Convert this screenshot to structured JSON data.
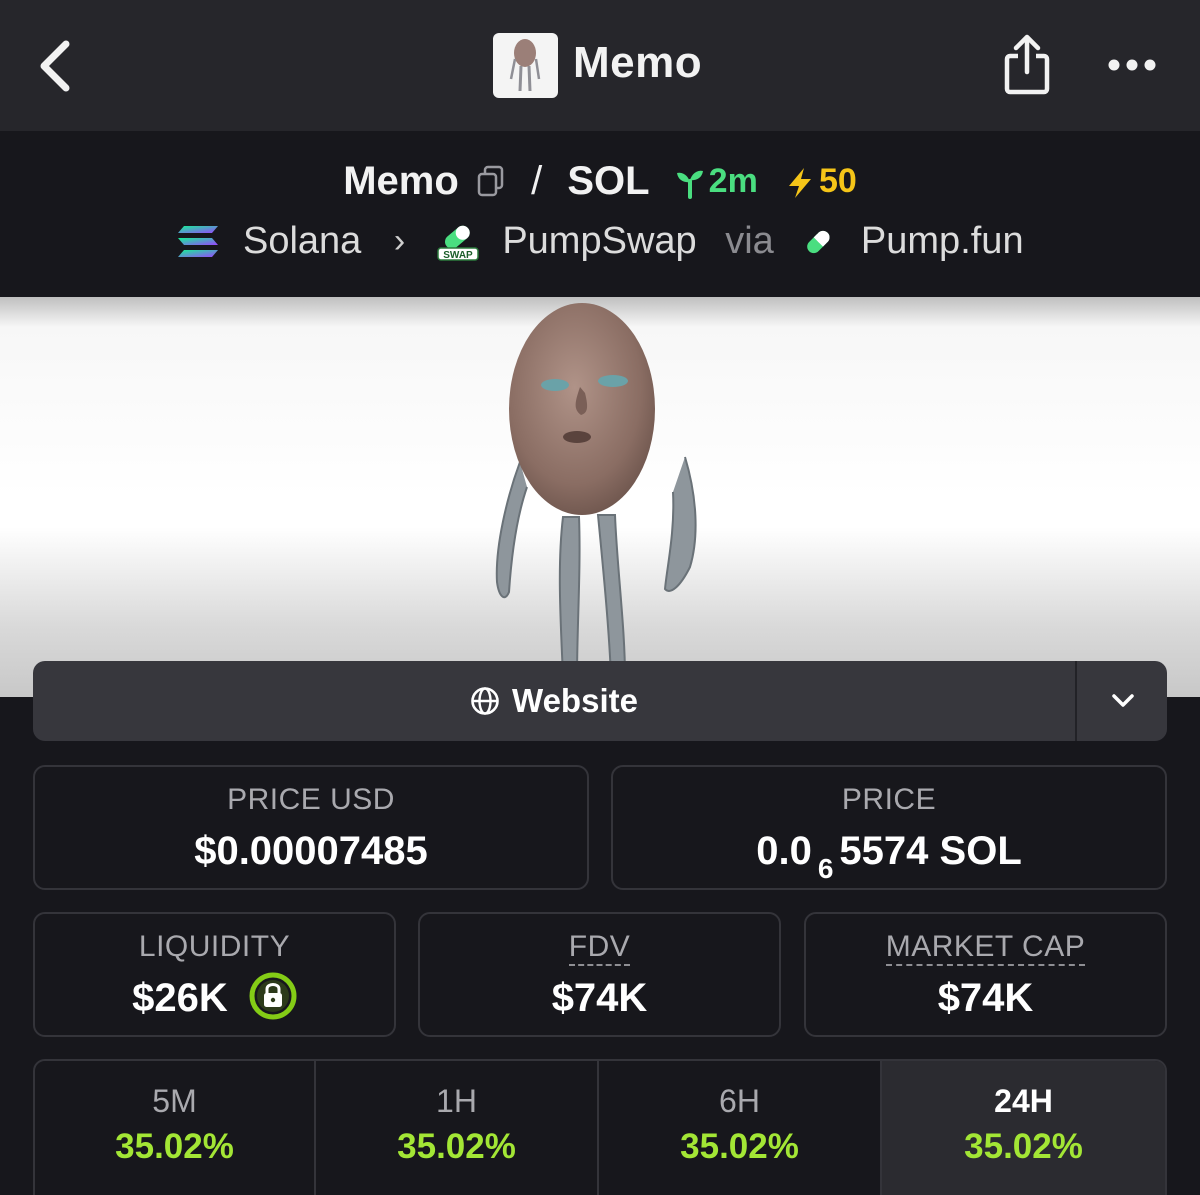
{
  "header": {
    "title": "Memo",
    "back_icon": "chevron-left-icon",
    "share_icon": "share-icon",
    "more_icon": "more-horizontal-icon"
  },
  "pair": {
    "base": "Memo",
    "separator": "/",
    "quote": "SOL",
    "age": "2m",
    "boosts": "50"
  },
  "route": {
    "chain": "Solana",
    "dex": "PumpSwap",
    "via_word": "via",
    "launchpad": "Pump.fun",
    "dex_badge": "SWAP"
  },
  "links": {
    "website_label": "Website"
  },
  "stats": {
    "price_usd_label": "PRICE USD",
    "price_usd_value": "$0.00007485",
    "price_label": "PRICE",
    "price_prefix": "0.0",
    "price_zero_count": "6",
    "price_suffix": "5574 SOL",
    "liquidity_label": "LIQUIDITY",
    "liquidity_value": "$26K",
    "fdv_label": "FDV",
    "fdv_value": "$74K",
    "mcap_label": "MARKET CAP",
    "mcap_value": "$74K"
  },
  "changes": [
    {
      "timeframe": "5M",
      "value": "35.02%"
    },
    {
      "timeframe": "1H",
      "value": "35.02%"
    },
    {
      "timeframe": "6H",
      "value": "35.02%"
    },
    {
      "timeframe": "24H",
      "value": "35.02%"
    }
  ],
  "colors": {
    "positive": "#a3e635",
    "age": "#4ade80",
    "boost": "#f5c518"
  }
}
